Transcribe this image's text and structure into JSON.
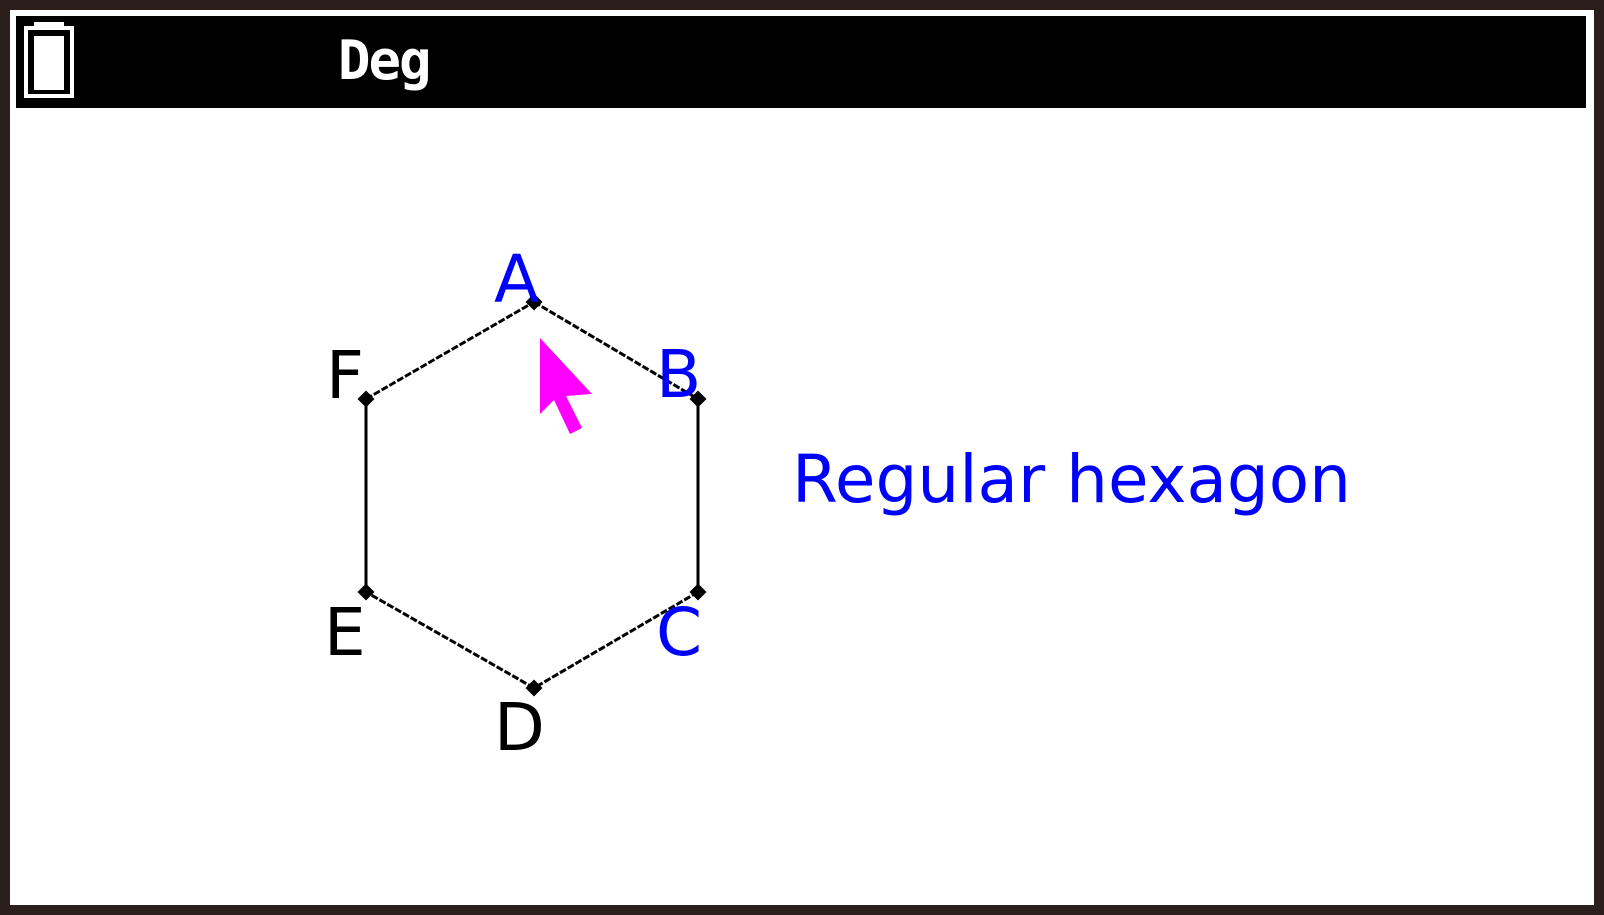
{
  "status_bar": {
    "battery_icon": "battery-icon",
    "angle_mode": "Deg"
  },
  "geometry": {
    "shape": "hexagon",
    "vertices": [
      {
        "label": "A",
        "color": "#0000ff"
      },
      {
        "label": "B",
        "color": "#0000ff"
      },
      {
        "label": "C",
        "color": "#0000ff"
      },
      {
        "label": "D",
        "color": "#000000"
      },
      {
        "label": "E",
        "color": "#000000"
      },
      {
        "label": "F",
        "color": "#000000"
      }
    ],
    "caption": "Regular hexagon",
    "caption_color": "#0000ff",
    "edge_color": "#000000"
  },
  "cursor": {
    "icon": "pointer-arrow-icon",
    "color": "#ff00ff"
  }
}
